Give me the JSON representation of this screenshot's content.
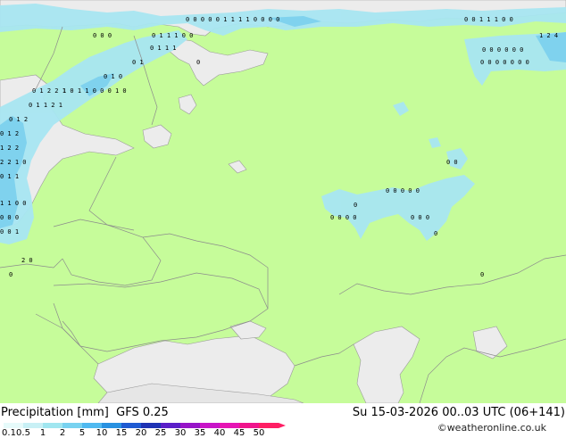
{
  "legend": {
    "title": "Precipitation [mm]",
    "model": "GFS 0.25",
    "datetime": "Su 15-03-2026 00..03 UTC (06+141)",
    "credit": "©weatheronline.co.uk",
    "scale": [
      {
        "label": "0.1",
        "color": "#e6fafa"
      },
      {
        "label": "0.5",
        "color": "#c8f0f5"
      },
      {
        "label": "1",
        "color": "#a0e6f0"
      },
      {
        "label": "2",
        "color": "#78d2f0"
      },
      {
        "label": "5",
        "color": "#50b9f0"
      },
      {
        "label": "10",
        "color": "#2891e1"
      },
      {
        "label": "15",
        "color": "#1e5ad2"
      },
      {
        "label": "20",
        "color": "#1e32b4"
      },
      {
        "label": "25",
        "color": "#5a1ec8"
      },
      {
        "label": "30",
        "color": "#9614c8"
      },
      {
        "label": "35",
        "color": "#c814c8"
      },
      {
        "label": "40",
        "color": "#e614b4"
      },
      {
        "label": "45",
        "color": "#f0148c"
      },
      {
        "label": "50",
        "color": "#ff1e64"
      }
    ]
  },
  "map": {
    "land_color": "#c6fc9a",
    "sea_color": "#ececec",
    "precip_color": "#a8e6f2",
    "precip_heavy_color": "#7fd2ee",
    "border_color": "#8c8c8c",
    "value_markers": {
      "zero_glyph": "0",
      "rows": [
        {
          "text": "0 0 0 0 0 1 1 1 1 0 0 0 0"
        },
        {
          "text": "0 0 0"
        },
        {
          "text": "0 1 1 1 0 0"
        },
        {
          "text": "0 0 1 1 1 0 0"
        },
        {
          "text": "0 0 0 0 0 0"
        },
        {
          "text": "0 0 0 0 0 0 0"
        },
        {
          "text": "1 2 4"
        },
        {
          "text": "0 1 2 2 1"
        },
        {
          "text": "0 1 1 2 1"
        },
        {
          "text": "0 1 2"
        },
        {
          "text": "2 2 1 0"
        },
        {
          "text": "1 1 0 0"
        },
        {
          "text": "1 0 1 1 0 0 0 1 0"
        },
        {
          "text": "0 1 1 1"
        },
        {
          "text": "0 0 0 0 0"
        },
        {
          "text": "0 0 0 0"
        },
        {
          "text": "0 0 0"
        },
        {
          "text": "2 0"
        },
        {
          "text": "0 0"
        }
      ]
    }
  }
}
